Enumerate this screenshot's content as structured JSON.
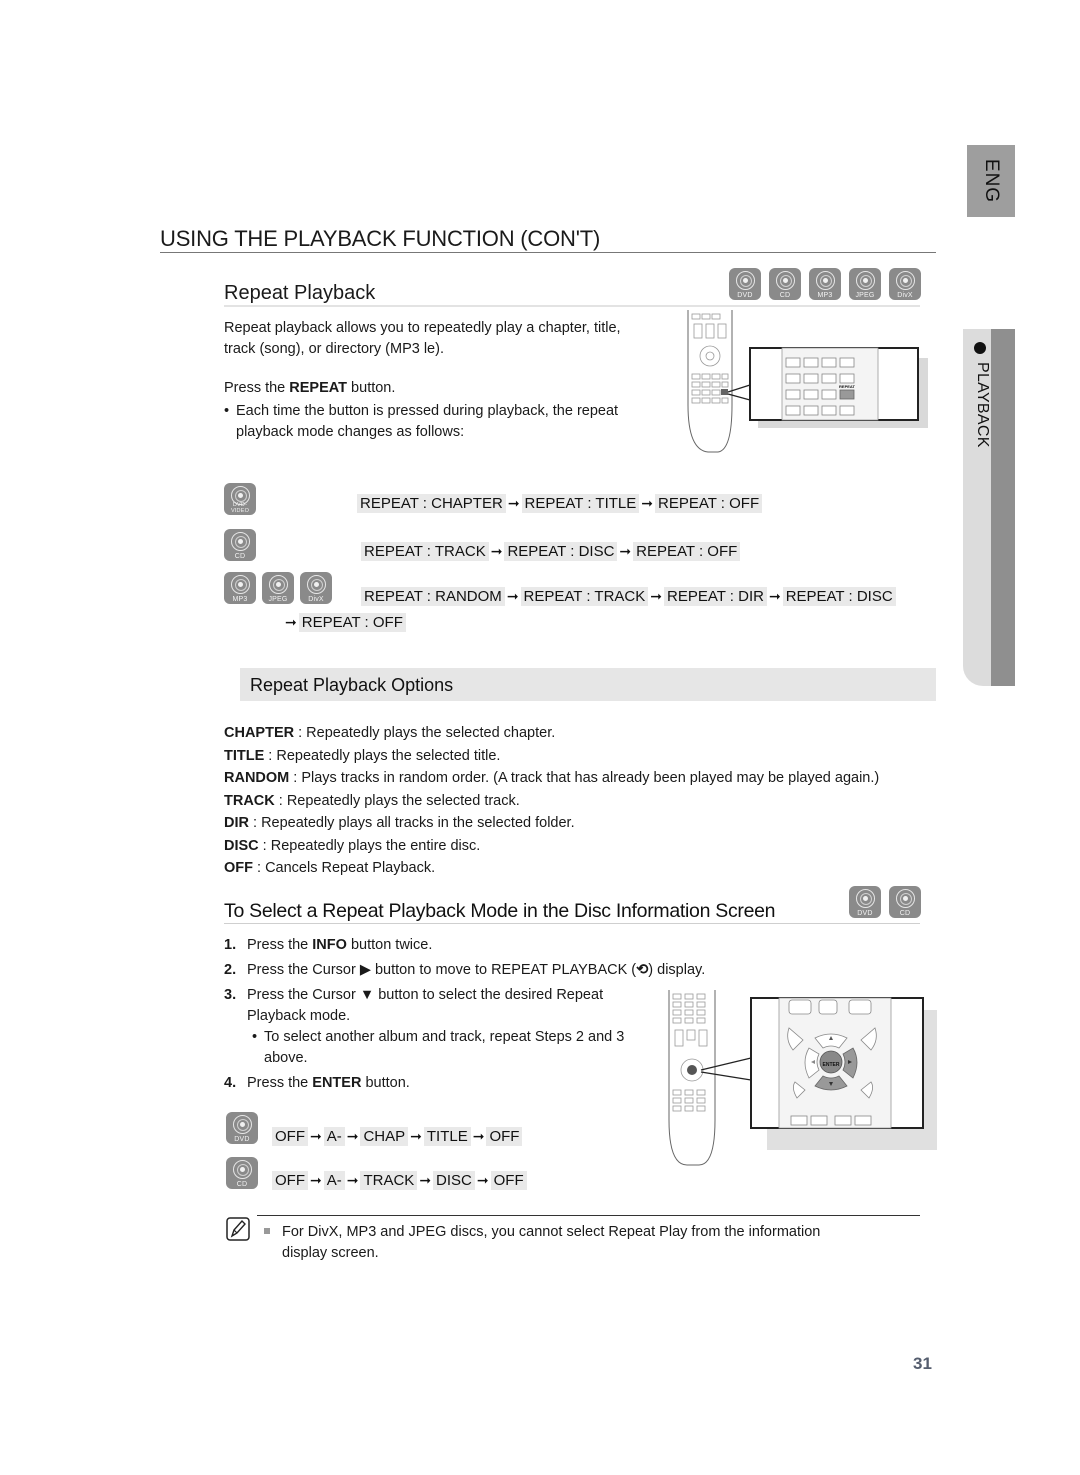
{
  "side_tabs": {
    "language": "ENG",
    "section": "PLAYBACK"
  },
  "page": {
    "title": "USING THE PLAYBACK FUNCTION (CON'T)",
    "number": "31"
  },
  "repeat_playback": {
    "heading": "Repeat Playback",
    "disc_types": [
      "DVD",
      "CD",
      "MP3",
      "JPEG",
      "DivX"
    ],
    "intro_line1": "Repeat playback allows you to repeatedly play a chapter, title,",
    "intro_line2": "track (song), or directory (MP3   le).",
    "press_prefix": "Press the ",
    "press_button": "REPEAT",
    "press_suffix": " button.",
    "bullet_line1": "Each time the button is pressed during playback, the repeat",
    "bullet_line2": "playback mode changes as follows:",
    "remote_highlight_label": "REPEAT",
    "sequences": [
      {
        "disc_icons": [
          "DVD-VIDEO"
        ],
        "steps": [
          "REPEAT : CHAPTER",
          "REPEAT : TITLE",
          "REPEAT : OFF"
        ]
      },
      {
        "disc_icons": [
          "CD"
        ],
        "steps": [
          "REPEAT : TRACK",
          "REPEAT : DISC",
          "REPEAT : OFF"
        ]
      },
      {
        "disc_icons": [
          "MP3",
          "JPEG",
          "DivX"
        ],
        "steps": [
          "REPEAT : RANDOM",
          "REPEAT : TRACK",
          "REPEAT : DIR",
          "REPEAT : DISC",
          "REPEAT : OFF"
        ]
      }
    ],
    "arrow": "➞"
  },
  "options": {
    "heading": "Repeat Playback Options",
    "items": [
      {
        "term": "CHAPTER",
        "desc": " : Repeatedly plays the selected chapter."
      },
      {
        "term": "TITLE",
        "desc": " : Repeatedly plays the selected title."
      },
      {
        "term": "RANDOM",
        "desc": " : Plays tracks in random order. (A track that has already been played may be played again.)"
      },
      {
        "term": "TRACK",
        "desc": " : Repeatedly plays the selected track."
      },
      {
        "term": "DIR",
        "desc": " : Repeatedly plays all tracks in the selected folder."
      },
      {
        "term": "DISC",
        "desc": " : Repeatedly plays the entire disc."
      },
      {
        "term": "OFF",
        "desc": " : Cancels Repeat Playback."
      }
    ]
  },
  "info_screen": {
    "heading": "To Select a Repeat Playback Mode in the Disc Information Screen",
    "disc_types": [
      "DVD",
      "CD"
    ],
    "steps": [
      {
        "num": "1.",
        "pre": "Press the ",
        "bold": "INFO",
        "post": " button twice."
      },
      {
        "num": "2.",
        "pre": "Press the Cursor ▶ button to move to REPEAT PLAYBACK (",
        "icon": "⟲",
        "post": ") display."
      },
      {
        "num": "3.",
        "pre": "Press the Cursor ▼ button to select the desired Repeat",
        "post2": "Playback mode."
      },
      {
        "num": "4.",
        "pre": "Press the ",
        "bold": "ENTER",
        "post": " button."
      }
    ],
    "sub_bullet_line1": "To select another album and track, repeat Steps 2 and 3",
    "sub_bullet_line2": "above.",
    "remote_enter_label": "ENTER",
    "sequences": [
      {
        "disc_icon": "DVD",
        "steps": [
          "OFF",
          "A-",
          "CHAP",
          "TITLE",
          "OFF"
        ]
      },
      {
        "disc_icon": "CD",
        "steps": [
          "OFF",
          "A-",
          "TRACK",
          "DISC",
          "OFF"
        ]
      }
    ]
  },
  "note": {
    "line1": "For DivX, MP3 and JPEG discs, you cannot select Repeat Play from the information",
    "line2": "display screen."
  }
}
